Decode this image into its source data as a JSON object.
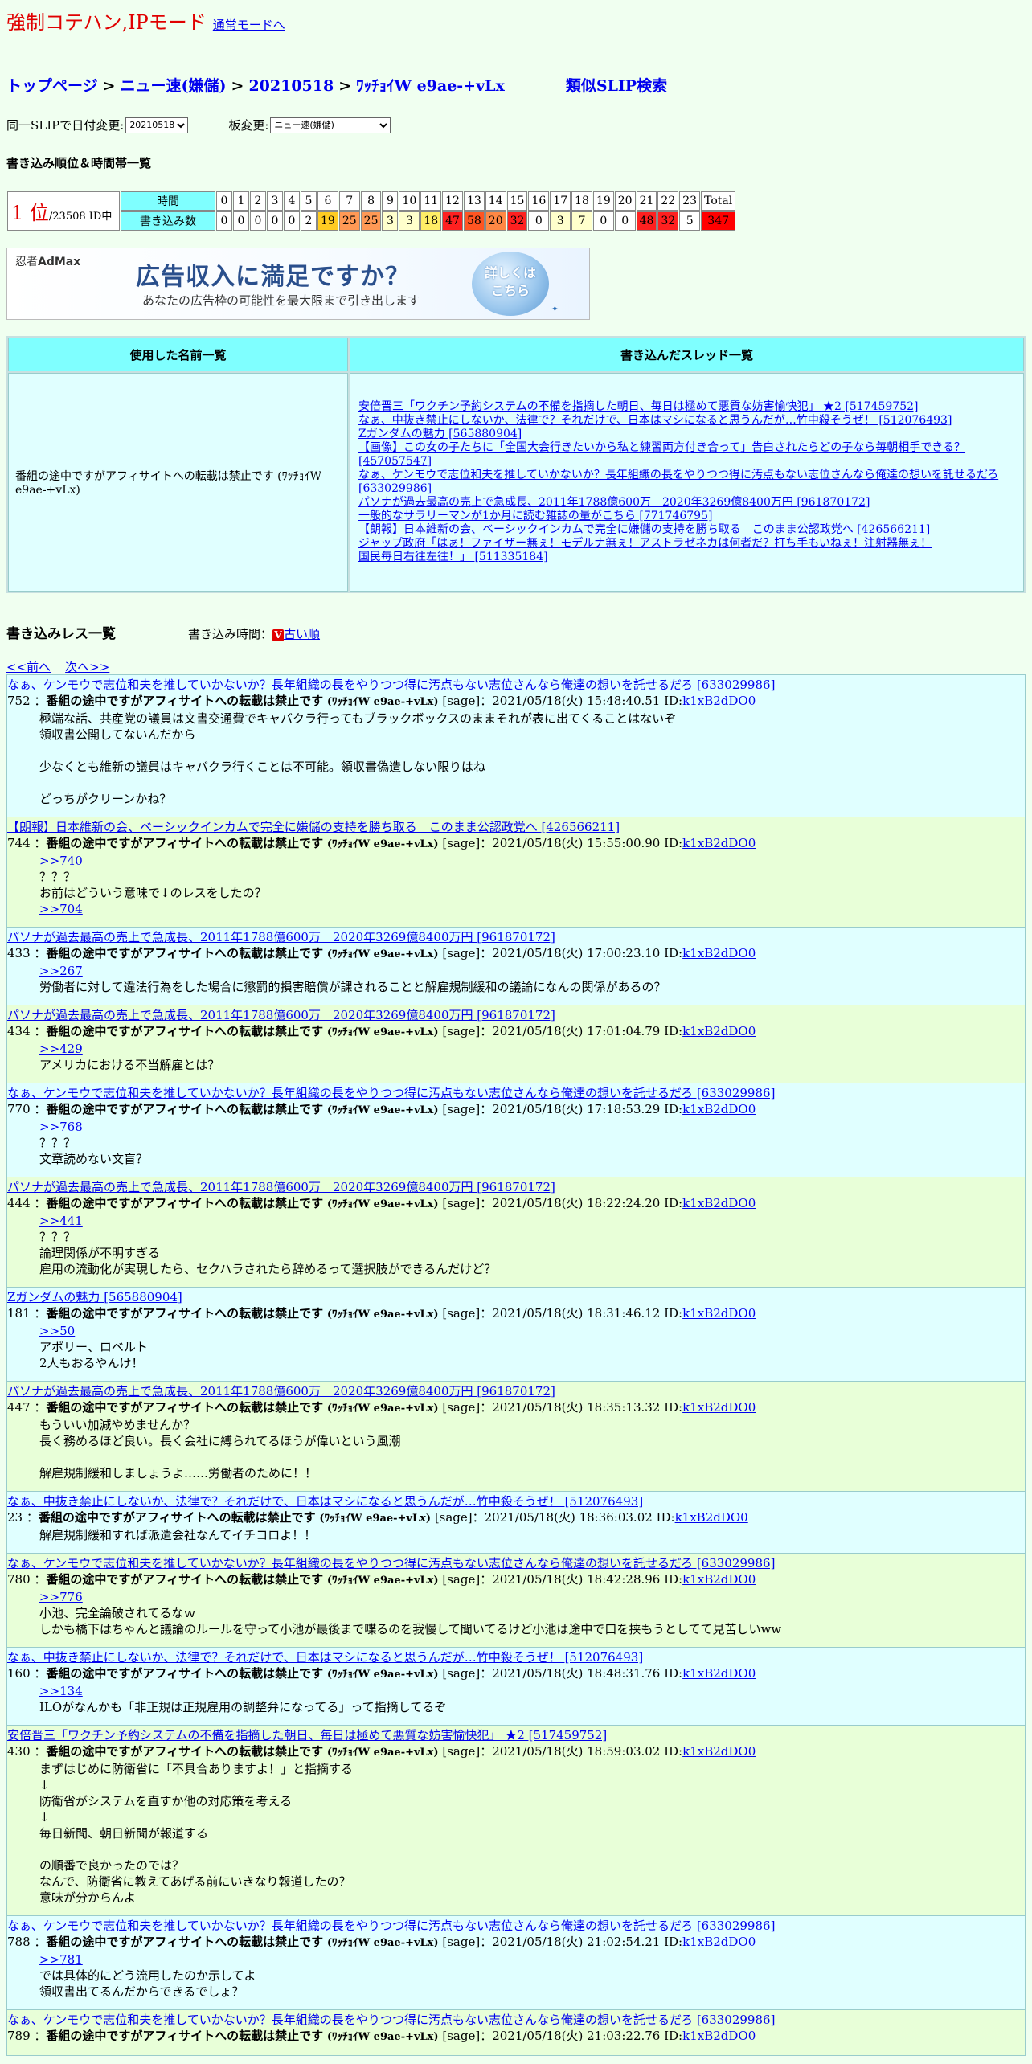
{
  "header": {
    "mode_title": "強制コテハン,IPモード",
    "normal_mode_link": "通常モードへ"
  },
  "nav": {
    "crumbs": [
      "トップページ",
      "ニュー速(嫌儲)",
      "20210518",
      "ﾜｯﾁｮｲW e9ae-+vLx"
    ],
    "separator": ">",
    "similar_slip": "類似SLIP検索"
  },
  "form": {
    "date_label": "同一SLIPで日付変更:",
    "date_value": "20210518",
    "board_label": "板変更:",
    "board_value": "ニュー速(嫌儲)"
  },
  "ranking": {
    "section_title": "書き込み順位＆時間帯一覧",
    "rank_num": "1 位",
    "rank_total": "/23508 ID中",
    "hours_header": "時間",
    "posts_header": "書き込み数",
    "hours": [
      "0",
      "1",
      "2",
      "3",
      "4",
      "5",
      "6",
      "7",
      "8",
      "9",
      "10",
      "11",
      "12",
      "13",
      "14",
      "15",
      "16",
      "17",
      "18",
      "19",
      "20",
      "21",
      "22",
      "23",
      "Total"
    ],
    "counts": [
      "0",
      "0",
      "0",
      "0",
      "0",
      "2",
      "19",
      "25",
      "25",
      "3",
      "3",
      "18",
      "47",
      "58",
      "20",
      "32",
      "0",
      "3",
      "7",
      "0",
      "0",
      "48",
      "32",
      "5",
      "347"
    ],
    "count_colors": [
      "#ffffff",
      "#ffffff",
      "#ffffff",
      "#ffffff",
      "#ffffff",
      "#ffffff",
      "#ffcc22",
      "#ff9955",
      "#ff9955",
      "#ffffcc",
      "#ffffcc",
      "#ffee66",
      "#ff2020",
      "#ff5522",
      "#ff8844",
      "#ff2020",
      "#ffffff",
      "#ffffcc",
      "#ffffcc",
      "#ffffff",
      "#ffffff",
      "#ff2020",
      "#ff2020",
      "#ffffff",
      "#ff0000"
    ]
  },
  "ad": {
    "logo_prefix": "忍者",
    "logo": "AdMax",
    "main": "広告収入に満足ですか？",
    "sub": "あなたの広告枠の可能性を最大限まで引き出します",
    "button_line1": "詳しくは",
    "button_line2": "こちら"
  },
  "lists": {
    "names_header": "使用した名前一覧",
    "threads_header": "書き込んだスレッド一覧",
    "name": "番組の途中ですがアフィサイトへの転載は禁止です (ﾜｯﾁｮｲW e9ae-+vLx)",
    "threads": [
      "安倍晋三「ワクチン予約システムの不備を指摘した朝日、毎日は極めて悪質な妨害愉快犯」 ★2 [517459752]",
      "なぁ、中抜き禁止にしないか、法律で？それだけで、日本はマシになると思うんだが…竹中殺そうぜ！ [512076493]",
      "Zガンダムの魅力 [565880904]",
      "【画像】この女の子たちに「全国大会行きたいから私と練習両方付き合って」告白されたらどの子なら毎朝相手できる？ [457057547]",
      "なぁ、ケンモウで志位和夫を推していかないか？長年組織の長をやりつつ得に汚点もない志位さんなら俺達の想いを託せるだろ [633029986]",
      "パソナが過去最高の売上で急成長、2011年1788億600万　2020年3269億8400万円 [961870172]",
      "一般的なサラリーマンが1か月に読む雑誌の量がこちら [771746795]",
      "【朗報】日本維新の会、ベーシックインカムで完全に嫌儲の支持を勝ち取る　このまま公認政党へ [426566211]",
      "ジャップ政府「はぁ！ファイザー無ぇ！モデルナ無ぇ！アストラゼネカは何者だ？打ち手もいねぇ！注射器無ぇ！",
      "国民毎日右往左往！」 [511335184]"
    ]
  },
  "responses": {
    "title": "書き込みレス一覧",
    "order_label": "書き込み時間：",
    "order_icon": "V",
    "order_link": "古い順",
    "prev": "<<前へ",
    "next": "次へ>>"
  },
  "posts": [
    {
      "thread": "なぁ、ケンモウで志位和夫を推していかないか？長年組織の長をやりつつ得に汚点もない志位さんなら俺達の想いを託せるだろ [633029986]",
      "num": "752",
      "name": "番組の途中ですがアフィサイトへの転載は禁止です",
      "slip": "(ﾜｯﾁｮｲW e9ae-+vLx)",
      "mail": "[sage]",
      "date": "：2021/05/18(火) 15:48:40.51 ID:",
      "id": "k1xB2dDO0",
      "anchors": [],
      "body": "極端な話、共産党の議員は文書交通費でキャバクラ行ってもブラックボックスのままそれが表に出てくることはないぞ\n領収書公開してないんだから\n\n少なくとも維新の議員はキャバクラ行くことは不可能。領収書偽造しない限りはね\n\nどっちがクリーンかね？"
    },
    {
      "thread": "【朗報】日本維新の会、ベーシックインカムで完全に嫌儲の支持を勝ち取る　このまま公認政党へ [426566211]",
      "num": "744",
      "name": "番組の途中ですがアフィサイトへの転載は禁止です",
      "slip": "(ﾜｯﾁｮｲW e9ae-+vLx)",
      "mail": "[sage]",
      "date": "：2021/05/18(火) 15:55:00.90 ID:",
      "id": "k1xB2dDO0",
      "anchors": [
        ">>740"
      ],
      "body": "？？？\nお前はどういう意味で↓のレスをしたの？",
      "anchors2": [
        ">>704"
      ]
    },
    {
      "thread": "パソナが過去最高の売上で急成長、2011年1788億600万　2020年3269億8400万円 [961870172]",
      "num": "433",
      "name": "番組の途中ですがアフィサイトへの転載は禁止です",
      "slip": "(ﾜｯﾁｮｲW e9ae-+vLx)",
      "mail": "[sage]",
      "date": "：2021/05/18(火) 17:00:23.10 ID:",
      "id": "k1xB2dDO0",
      "anchors": [
        ">>267"
      ],
      "body": "労働者に対して違法行為をした場合に懲罰的損害賠償が課されることと解雇規制緩和の議論になんの関係があるの？"
    },
    {
      "thread": "パソナが過去最高の売上で急成長、2011年1788億600万　2020年3269億8400万円 [961870172]",
      "num": "434",
      "name": "番組の途中ですがアフィサイトへの転載は禁止です",
      "slip": "(ﾜｯﾁｮｲW e9ae-+vLx)",
      "mail": "[sage]",
      "date": "：2021/05/18(火) 17:01:04.79 ID:",
      "id": "k1xB2dDO0",
      "anchors": [
        ">>429"
      ],
      "body": "アメリカにおける不当解雇とは？"
    },
    {
      "thread": "なぁ、ケンモウで志位和夫を推していかないか？長年組織の長をやりつつ得に汚点もない志位さんなら俺達の想いを託せるだろ [633029986]",
      "num": "770",
      "name": "番組の途中ですがアフィサイトへの転載は禁止です",
      "slip": "(ﾜｯﾁｮｲW e9ae-+vLx)",
      "mail": "[sage]",
      "date": "：2021/05/18(火) 17:18:53.29 ID:",
      "id": "k1xB2dDO0",
      "anchors": [
        ">>768"
      ],
      "body": "？？？\n文章読めない文盲？"
    },
    {
      "thread": "パソナが過去最高の売上で急成長、2011年1788億600万　2020年3269億8400万円 [961870172]",
      "num": "444",
      "name": "番組の途中ですがアフィサイトへの転載は禁止です",
      "slip": "(ﾜｯﾁｮｲW e9ae-+vLx)",
      "mail": "[sage]",
      "date": "：2021/05/18(火) 18:22:24.20 ID:",
      "id": "k1xB2dDO0",
      "anchors": [
        ">>441"
      ],
      "body": "？？？\n論理関係が不明すぎる\n雇用の流動化が実現したら、セクハラされたら辞めるって選択肢ができるんだけど？"
    },
    {
      "thread": "Zガンダムの魅力 [565880904]",
      "num": "181",
      "name": "番組の途中ですがアフィサイトへの転載は禁止です",
      "slip": "(ﾜｯﾁｮｲW e9ae-+vLx)",
      "mail": "[sage]",
      "date": "：2021/05/18(火) 18:31:46.12 ID:",
      "id": "k1xB2dDO0",
      "anchors": [
        ">>50"
      ],
      "body": "アポリー、ロベルト\n2人もおるやんけ！"
    },
    {
      "thread": "パソナが過去最高の売上で急成長、2011年1788億600万　2020年3269億8400万円 [961870172]",
      "num": "447",
      "name": "番組の途中ですがアフィサイトへの転載は禁止です",
      "slip": "(ﾜｯﾁｮｲW e9ae-+vLx)",
      "mail": "[sage]",
      "date": "：2021/05/18(火) 18:35:13.32 ID:",
      "id": "k1xB2dDO0",
      "anchors": [],
      "body": "もういい加減やめませんか？\n長く務めるほど良い。長く会社に縛られてるほうが偉いという風潮\n\n解雇規制緩和しましょうよ……労働者のために！！"
    },
    {
      "thread": "なぁ、中抜き禁止にしないか、法律で？それだけで、日本はマシになると思うんだが…竹中殺そうぜ！ [512076493]",
      "num": "23",
      "name": "番組の途中ですがアフィサイトへの転載は禁止です",
      "slip": "(ﾜｯﾁｮｲW e9ae-+vLx)",
      "mail": "[sage]",
      "date": "：2021/05/18(火) 18:36:03.02 ID:",
      "id": "k1xB2dDO0",
      "anchors": [],
      "body": "解雇規制緩和すれば派遣会社なんてイチコロよ！！"
    },
    {
      "thread": "なぁ、ケンモウで志位和夫を推していかないか？長年組織の長をやりつつ得に汚点もない志位さんなら俺達の想いを託せるだろ [633029986]",
      "num": "780",
      "name": "番組の途中ですがアフィサイトへの転載は禁止です",
      "slip": "(ﾜｯﾁｮｲW e9ae-+vLx)",
      "mail": "[sage]",
      "date": "：2021/05/18(火) 18:42:28.96 ID:",
      "id": "k1xB2dDO0",
      "anchors": [
        ">>776"
      ],
      "body": "小池、完全論破されてるなｗ\nしかも橋下はちゃんと議論のルールを守って小池が最後まで喋るのを我慢して聞いてるけど小池は途中で口を挟もうとしてて見苦しいww"
    },
    {
      "thread": "なぁ、中抜き禁止にしないか、法律で？それだけで、日本はマシになると思うんだが…竹中殺そうぜ！ [512076493]",
      "num": "160",
      "name": "番組の途中ですがアフィサイトへの転載は禁止です",
      "slip": "(ﾜｯﾁｮｲW e9ae-+vLx)",
      "mail": "[sage]",
      "date": "：2021/05/18(火) 18:48:31.76 ID:",
      "id": "k1xB2dDO0",
      "anchors": [
        ">>134"
      ],
      "body": "ILOがなんかも「非正規は正規雇用の調整弁になってる」って指摘してるぞ"
    },
    {
      "thread": "安倍晋三「ワクチン予約システムの不備を指摘した朝日、毎日は極めて悪質な妨害愉快犯」 ★2 [517459752]",
      "num": "430",
      "name": "番組の途中ですがアフィサイトへの転載は禁止です",
      "slip": "(ﾜｯﾁｮｲW e9ae-+vLx)",
      "mail": "[sage]",
      "date": "：2021/05/18(火) 18:59:03.02 ID:",
      "id": "k1xB2dDO0",
      "anchors": [],
      "body": "まずはじめに防衛省に「不具合ありますよ！」と指摘する\n↓\n防衛省がシステムを直すか他の対応策を考える\n↓\n毎日新聞、朝日新聞が報道する\n\nの順番で良かったのでは？\nなんで、防衛省に教えてあげる前にいきなり報道したの？\n意味が分からんよ"
    },
    {
      "thread": "なぁ、ケンモウで志位和夫を推していかないか？長年組織の長をやりつつ得に汚点もない志位さんなら俺達の想いを託せるだろ [633029986]",
      "num": "788",
      "name": "番組の途中ですがアフィサイトへの転載は禁止です",
      "slip": "(ﾜｯﾁｮｲW e9ae-+vLx)",
      "mail": "[sage]",
      "date": "：2021/05/18(火) 21:02:54.21 ID:",
      "id": "k1xB2dDO0",
      "anchors": [
        ">>781"
      ],
      "body": "では具体的にどう流用したのか示してよ\n領収書出てるんだからできるでしょ？"
    },
    {
      "thread": "なぁ、ケンモウで志位和夫を推していかないか？長年組織の長をやりつつ得に汚点もない志位さんなら俺達の想いを託せるだろ [633029986]",
      "num": "789",
      "name": "番組の途中ですがアフィサイトへの転載は禁止です",
      "slip": "(ﾜｯﾁｮｲW e9ae-+vLx)",
      "mail": "[sage]",
      "date": "：2021/05/18(火) 21:03:22.76 ID:",
      "id": "k1xB2dDO0",
      "anchors": [],
      "body": ""
    }
  ]
}
